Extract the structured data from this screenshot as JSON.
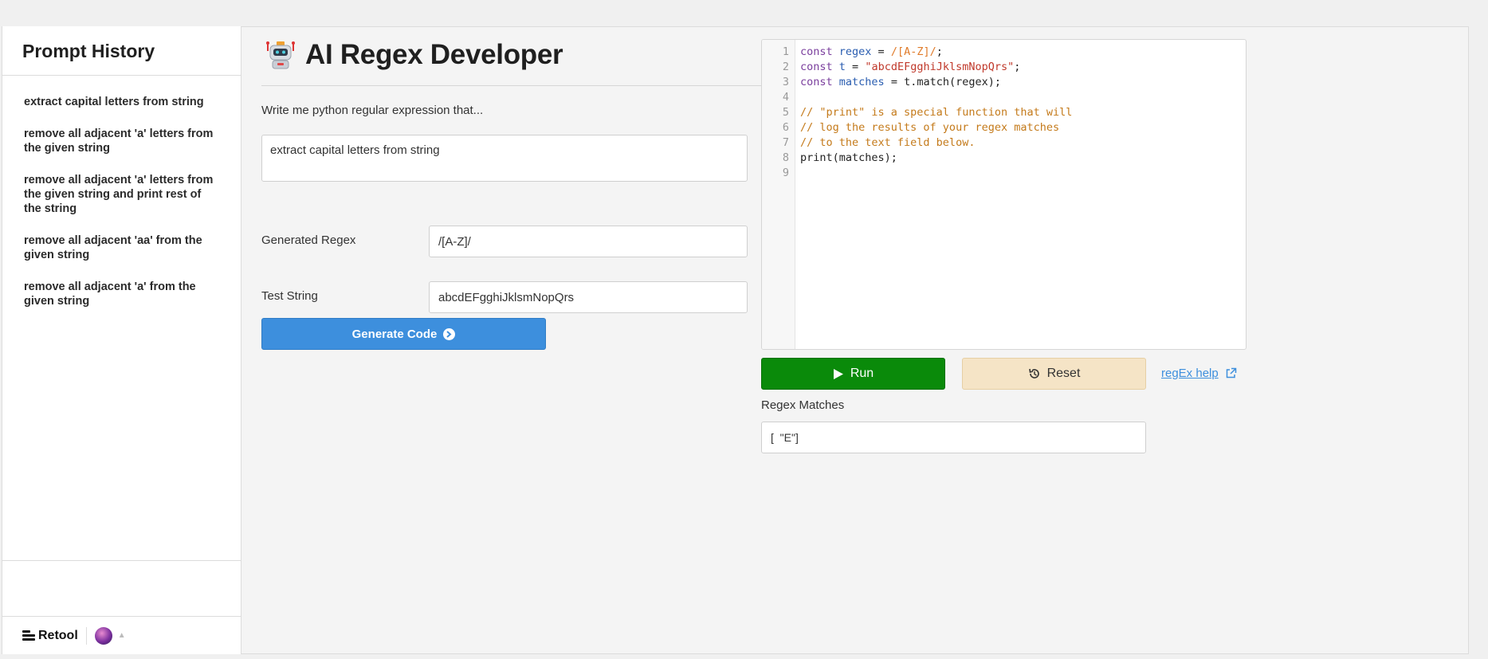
{
  "sidebar": {
    "title": "Prompt History",
    "items": [
      "extract capital letters from string",
      "remove all adjacent 'a' letters from the given string",
      "remove all adjacent 'a' letters from the given string and print rest of the string",
      "remove all adjacent 'aa' from the given string",
      "remove all adjacent 'a' from the given string"
    ],
    "footer": {
      "brand": "Retool"
    }
  },
  "main": {
    "title": "AI Regex Developer",
    "prompt_label": "Write me python regular expression that...",
    "prompt_value": "extract capital letters from string",
    "generated_regex_label": "Generated Regex",
    "generated_regex_value": "/[A-Z]/",
    "test_string_label": "Test String",
    "test_string_value": "abcdEFgghiJklsmNopQrs",
    "generate_button": "Generate Code"
  },
  "editor": {
    "line_numbers": [
      "1",
      "2",
      "3",
      "4",
      "5",
      "6",
      "7",
      "8",
      "9"
    ],
    "l1": {
      "kw": "const",
      "name": "regex",
      "op": " = ",
      "val": "/[A-Z]/",
      "end": ";"
    },
    "l2": {
      "kw": "const",
      "name": "t",
      "op": " = ",
      "val": "\"abcdEFgghiJklsmNopQrs\"",
      "end": ";"
    },
    "l3": {
      "kw": "const",
      "name": "matches",
      "rest": " = t.match(regex);"
    },
    "l5": "// \"print\" is a special function that will",
    "l6": "// log the results of your regex matches",
    "l7": "// to the text field below.",
    "l8": "print(matches);"
  },
  "actions": {
    "run": "Run",
    "reset": "Reset",
    "help": "regEx help"
  },
  "results": {
    "label": "Regex Matches",
    "value": "[  \"E\"]"
  },
  "colors": {
    "primary": "#3d8fdd",
    "run": "#0a8a0a",
    "reset": "#f5e4c6"
  }
}
